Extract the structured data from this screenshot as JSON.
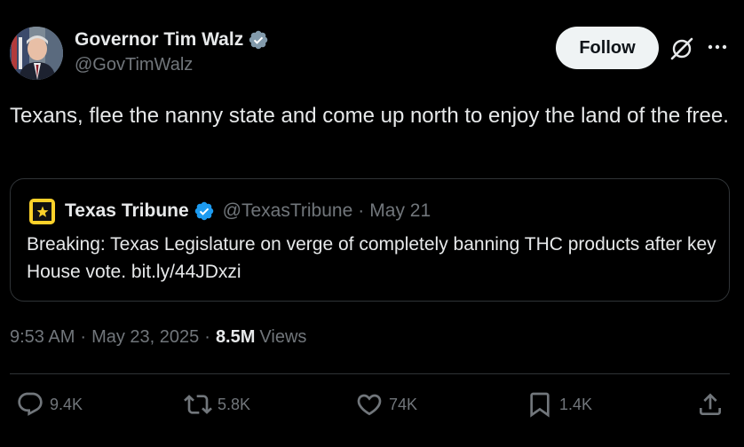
{
  "author": {
    "display_name": "Governor Tim Walz",
    "handle": "@GovTimWalz"
  },
  "follow_label": "Follow",
  "tweet_text": "Texans, flee the nanny state and come up north to enjoy the land of the free.",
  "quote": {
    "display_name": "Texas Tribune",
    "handle": "@TexasTribune",
    "separator": "·",
    "date": "May 21",
    "text": "Breaking: Texas Legislature on verge of completely banning THC products after key House vote. bit.ly/44JDxzi"
  },
  "meta": {
    "time": "9:53 AM",
    "separator": "·",
    "date": "May 23, 2025",
    "views_count": "8.5M",
    "views_label": "Views"
  },
  "actions": {
    "replies": "9.4K",
    "reposts": "5.8K",
    "likes": "74K",
    "bookmarks": "1.4K"
  },
  "colors": {
    "background": "#000000",
    "text": "#e7e9ea",
    "secondary": "#71767b",
    "verified_blue": "#1d9bf0",
    "verified_gray": "#829aab",
    "tribune_yellow": "#fcd12a"
  }
}
